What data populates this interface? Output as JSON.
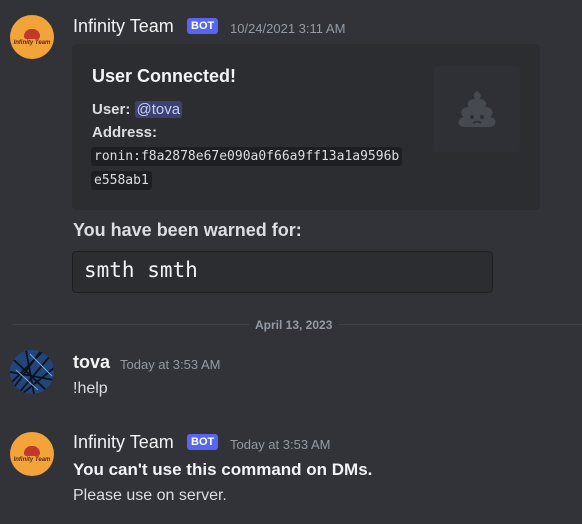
{
  "colors": {
    "background": "#313338",
    "embed_background": "#2b2d31",
    "bot_tag": "#5865f2",
    "mention_bg": "#3c4270",
    "text": "#dbdee1",
    "muted": "#949ba4"
  },
  "messages": [
    {
      "author": "Infinity Team",
      "bot_tag": "BOT",
      "avatar_text": "Infinity Team",
      "avatar_icon": "infinity-team-logo-icon",
      "timestamp": "10/24/2021 3:11 AM",
      "embed": {
        "title": "User Connected!",
        "user_label": "User:",
        "user_mention": "@tova",
        "address_label": "Address:",
        "address_line1": "ronin:f8a2878e67e090a0f66a9ff13a1a9596b",
        "address_line2": "e558ab1",
        "thumbnail_icon": "poop-emoji-icon"
      },
      "warning_title": "You have been warned for:",
      "warning_reason": "smth smth"
    },
    {
      "author": "tova",
      "avatar_icon": "user-avatar-lines-icon",
      "timestamp": "Today at 3:53 AM",
      "text": "!help"
    },
    {
      "author": "Infinity Team",
      "bot_tag": "BOT",
      "avatar_text": "Infinity Team",
      "avatar_icon": "infinity-team-logo-icon",
      "timestamp": "Today at 3:53 AM",
      "bold_text": "You can't use this command on DMs.",
      "text": "Please use on server."
    }
  ],
  "date_divider": "April 13, 2023"
}
